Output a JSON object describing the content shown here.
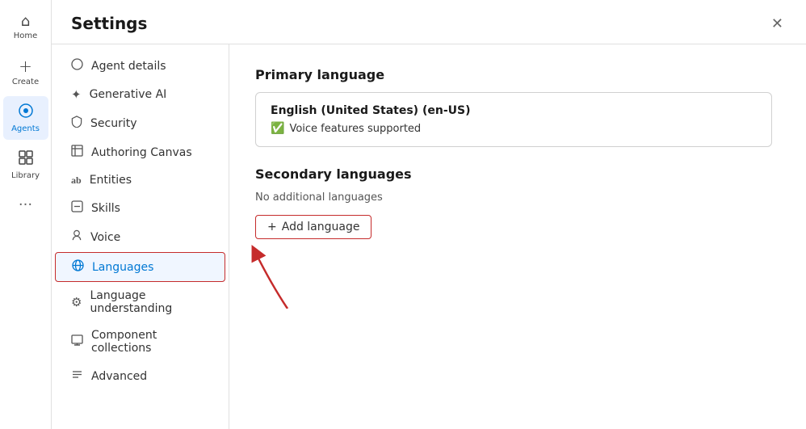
{
  "leftNav": {
    "items": [
      {
        "id": "home",
        "label": "Home",
        "icon": "⌂",
        "active": false
      },
      {
        "id": "create",
        "label": "Create",
        "icon": "+",
        "active": false
      },
      {
        "id": "agents",
        "label": "Agents",
        "icon": "◉",
        "active": true
      },
      {
        "id": "library",
        "label": "Library",
        "icon": "▦",
        "active": false
      }
    ],
    "moreIcon": "···"
  },
  "settings": {
    "title": "Settings",
    "closeLabel": "✕",
    "sidebar": {
      "items": [
        {
          "id": "agent-details",
          "label": "Agent details",
          "icon": "○",
          "active": false
        },
        {
          "id": "generative-ai",
          "label": "Generative AI",
          "icon": "✦",
          "active": false
        },
        {
          "id": "security",
          "label": "Security",
          "icon": "🔒",
          "active": false
        },
        {
          "id": "authoring-canvas",
          "label": "Authoring Canvas",
          "icon": "⊞",
          "active": false
        },
        {
          "id": "entities",
          "label": "Entities",
          "icon": "ab",
          "active": false
        },
        {
          "id": "skills",
          "label": "Skills",
          "icon": "⊟",
          "active": false
        },
        {
          "id": "voice",
          "label": "Voice",
          "icon": "👤",
          "active": false
        },
        {
          "id": "languages",
          "label": "Languages",
          "icon": "🌐",
          "active": true
        },
        {
          "id": "language-understanding",
          "label": "Language understanding",
          "icon": "⚙",
          "active": false
        },
        {
          "id": "component-collections",
          "label": "Component collections",
          "icon": "🖨",
          "active": false
        },
        {
          "id": "advanced",
          "label": "Advanced",
          "icon": "≈",
          "active": false
        }
      ]
    },
    "content": {
      "primaryLanguage": {
        "sectionTitle": "Primary language",
        "languageName": "English (United States) (en-US)",
        "voiceSupported": "Voice features supported"
      },
      "secondaryLanguages": {
        "sectionTitle": "Secondary languages",
        "noLanguagesText": "No additional languages",
        "addLanguageLabel": "+ Add language"
      }
    }
  }
}
